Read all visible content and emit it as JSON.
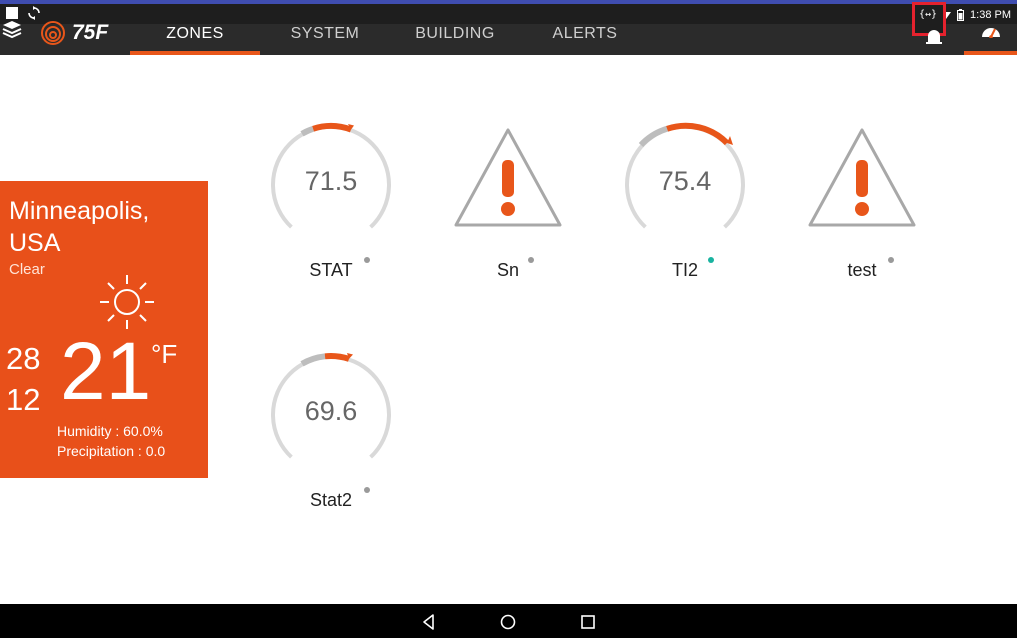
{
  "status_bar": {
    "time": "1:38 PM",
    "dev_icon_text": "{↔}"
  },
  "header": {
    "logo_text": "75F",
    "tabs": [
      {
        "label": "ZONES",
        "active": true
      },
      {
        "label": "SYSTEM",
        "active": false
      },
      {
        "label": "BUILDING",
        "active": false
      },
      {
        "label": "ALERTS",
        "active": false
      }
    ]
  },
  "weather": {
    "city": "Minneapolis, USA",
    "condition": "Clear",
    "high": "28",
    "low": "12",
    "temperature": "21",
    "unit": "°F",
    "humidity": "Humidity : 60.0%",
    "precipitation": "Precipitation : 0.0"
  },
  "zones": [
    {
      "name": "STAT",
      "value": "71.5",
      "type": "dial",
      "status_color": "gray"
    },
    {
      "name": "Sn",
      "value": "",
      "type": "alert",
      "status_color": "gray"
    },
    {
      "name": "TI2",
      "value": "75.4",
      "type": "dial",
      "status_color": "teal"
    },
    {
      "name": "test",
      "value": "",
      "type": "alert",
      "status_color": "gray"
    },
    {
      "name": "Stat2",
      "value": "69.6",
      "type": "dial",
      "status_color": "gray"
    }
  ],
  "colors": {
    "accent": "#e8561a",
    "weather_bg": "#e8501a",
    "topbar": "#2b2b2b",
    "online_dot": "#19b3a0",
    "offline_dot": "#9a9a9a"
  }
}
